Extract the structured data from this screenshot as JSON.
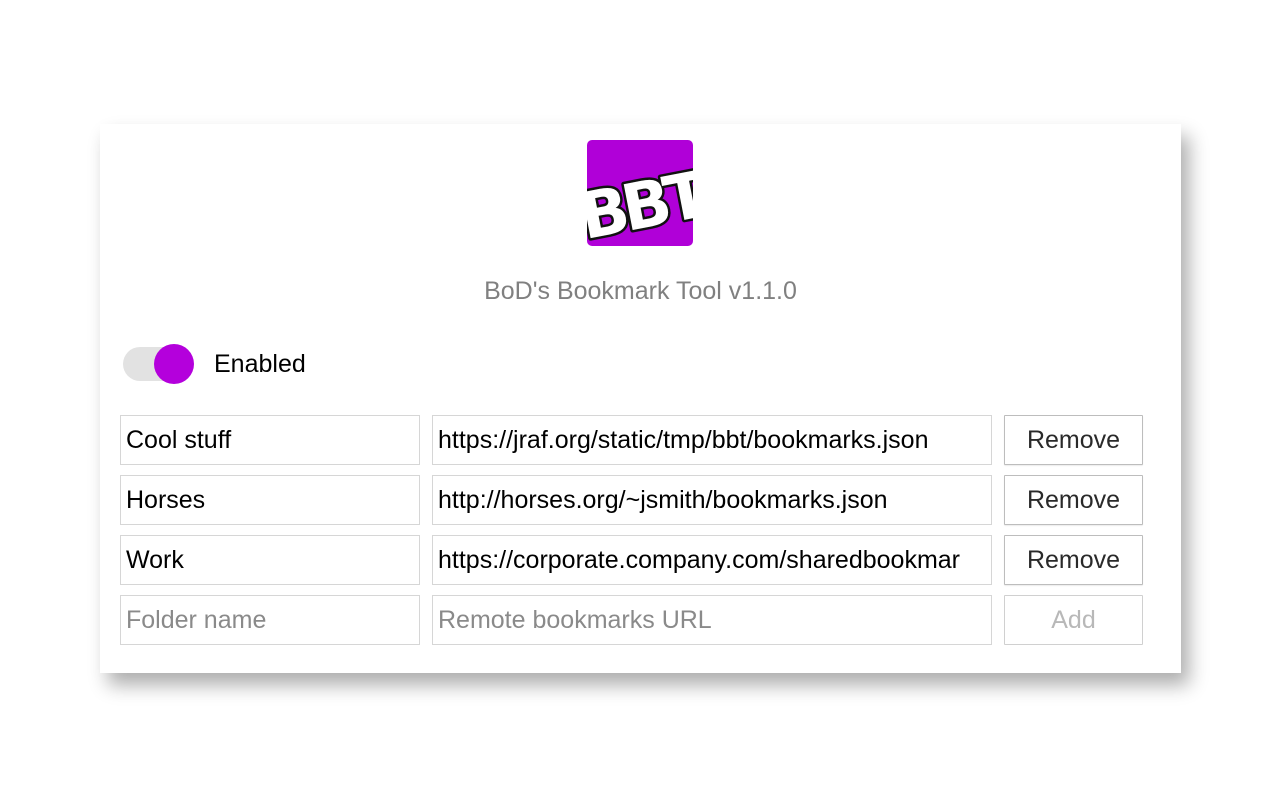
{
  "app": {
    "logo_text": "BBT",
    "title": "BoD's Bookmark Tool v1.1.0",
    "brand_color": "#b400dc"
  },
  "toggle": {
    "label": "Enabled",
    "checked": true
  },
  "rows": [
    {
      "folder": "Cool stuff",
      "url": "https://jraf.org/static/tmp/bbt/bookmarks.json",
      "button": "Remove"
    },
    {
      "folder": "Horses",
      "url": "http://horses.org/~jsmith/bookmarks.json",
      "button": "Remove"
    },
    {
      "folder": "Work",
      "url": "https://corporate.company.com/sharedbookmar",
      "button": "Remove"
    }
  ],
  "new_row": {
    "folder_placeholder": "Folder name",
    "url_placeholder": "Remote bookmarks URL",
    "button": "Add"
  }
}
